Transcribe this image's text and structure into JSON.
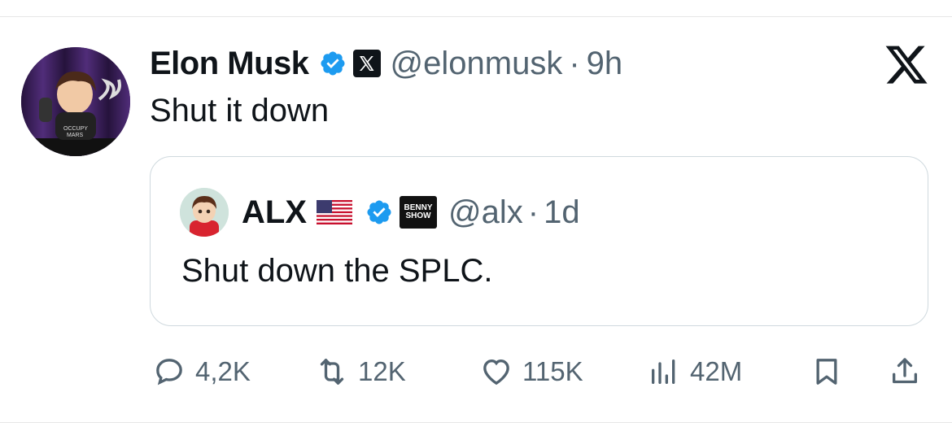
{
  "tweet": {
    "author_name": "Elon Musk",
    "handle": "@elonmusk",
    "separator": "·",
    "time": "9h",
    "text": "Shut it down"
  },
  "quoted_tweet": {
    "author_name": "ALX",
    "affiliate_label_line1": "BENNY",
    "affiliate_label_line2": "SHOW",
    "handle": "@alx",
    "separator": "·",
    "time": "1d",
    "text": "Shut down the SPLC."
  },
  "actions": {
    "replies": "4,2K",
    "reposts": "12K",
    "likes": "115K",
    "views": "42M"
  },
  "colors": {
    "verified_blue": "#1d9bf0",
    "muted_text": "#536471",
    "border": "#cfd9de"
  },
  "icons": [
    "verified-badge-icon",
    "x-affiliate-icon",
    "x-logo-icon",
    "us-flag-icon",
    "reply-icon",
    "repost-icon",
    "like-icon",
    "views-icon",
    "bookmark-icon",
    "share-icon"
  ]
}
